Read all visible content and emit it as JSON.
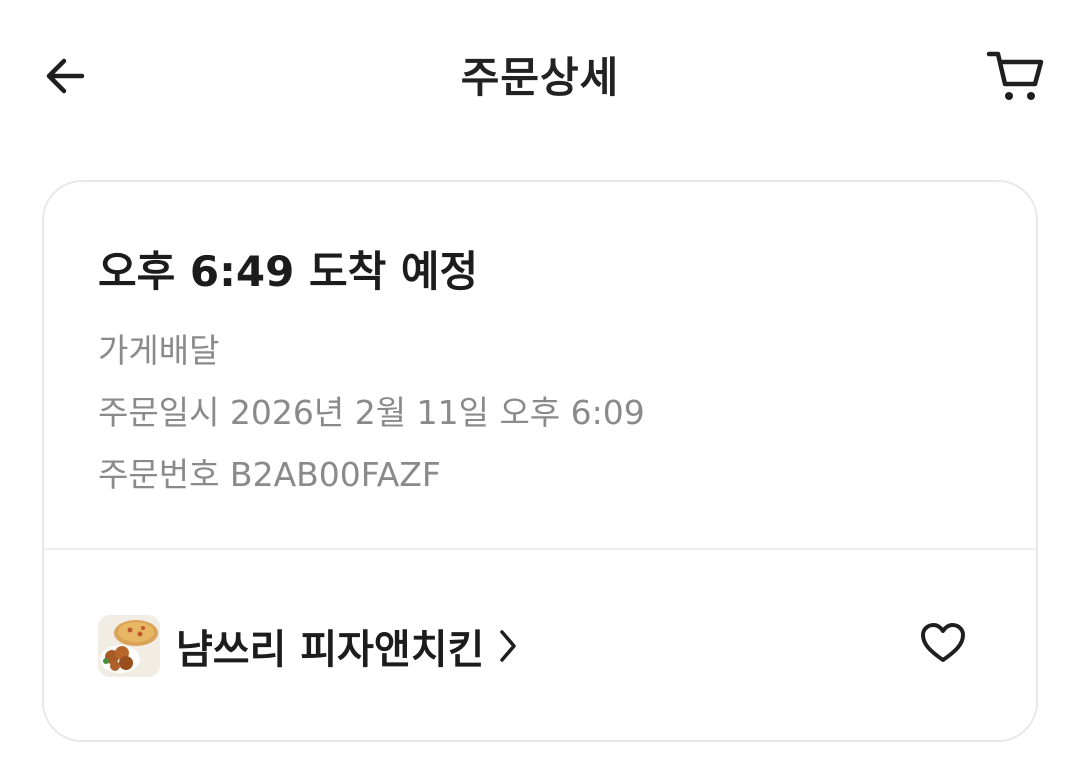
{
  "header": {
    "title": "주문상세",
    "back_icon": "arrow-left-icon",
    "cart_icon": "cart-icon"
  },
  "order": {
    "arrival_text": "오후 6:49 도착 예정",
    "delivery_type": "가게배달",
    "order_date": "주문일시 2026년 2월 11일 오후 6:09",
    "order_number": "주문번호 B2AB00FAZF"
  },
  "store": {
    "name": "냠쓰리 피자앤치킨",
    "thumb_icon": "pizza-chicken-thumbnail",
    "favorite_icon": "heart-outline-icon"
  },
  "colors": {
    "text_primary": "#1c1c1c",
    "text_secondary": "#8a8a8a",
    "border": "#e8e8e8"
  }
}
